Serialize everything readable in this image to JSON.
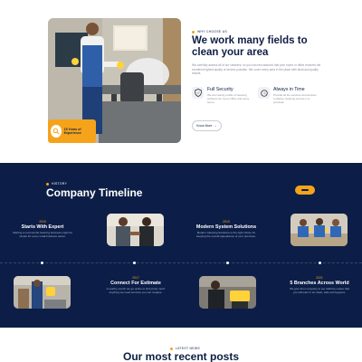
{
  "about": {
    "badge": {
      "text": "15 Years of Experience"
    },
    "kicker": "Why Choose Us",
    "title": "We work many fields to clean your area",
    "description": "We carefully assess all of our cleaners, so you can rest assured that your home or office receives the excellent highest quality of service possible. We cover every area in the place with ideal and quality results.",
    "features": [
      {
        "title": "Full Security",
        "description": "We are raising profile of cleaning solutions for every office and every home.",
        "icon": "shield-check-icon"
      },
      {
        "title": "Always in Time",
        "description": "Provide all the services and devices to deliver cleaning service in a punctual.",
        "icon": "clock-icon"
      }
    ],
    "read_more_label": "Know More"
  },
  "timeline": {
    "kicker": "History",
    "title": "Company Timeline",
    "events": [
      {
        "year": "2015",
        "title": "Starts With Expert",
        "description": "Starting a commercial cleaning business might be simple for every small business owner."
      },
      {
        "year": "2017",
        "title": "Connect For Estimate",
        "description": "A nearby scorch we go online to find pretty much anything we need services you can imagine."
      },
      {
        "year": "2019",
        "title": "Modern System Solutions",
        "description": "Modern Cleaning Solutions is the right choice for keeping the overall appearance of your premises."
      },
      {
        "year": "2021",
        "title": "5 Branches Across World",
        "description": "We give from company to our staff the nature that you will want in an intact, safe and hygienic."
      }
    ]
  },
  "posts": {
    "kicker": "Latest News",
    "title": "Our most recent posts"
  },
  "colors": {
    "navy": "#0c1e47",
    "accent": "#f5a31a",
    "heading": "#0e1d45",
    "muted": "#8a8f9c"
  }
}
